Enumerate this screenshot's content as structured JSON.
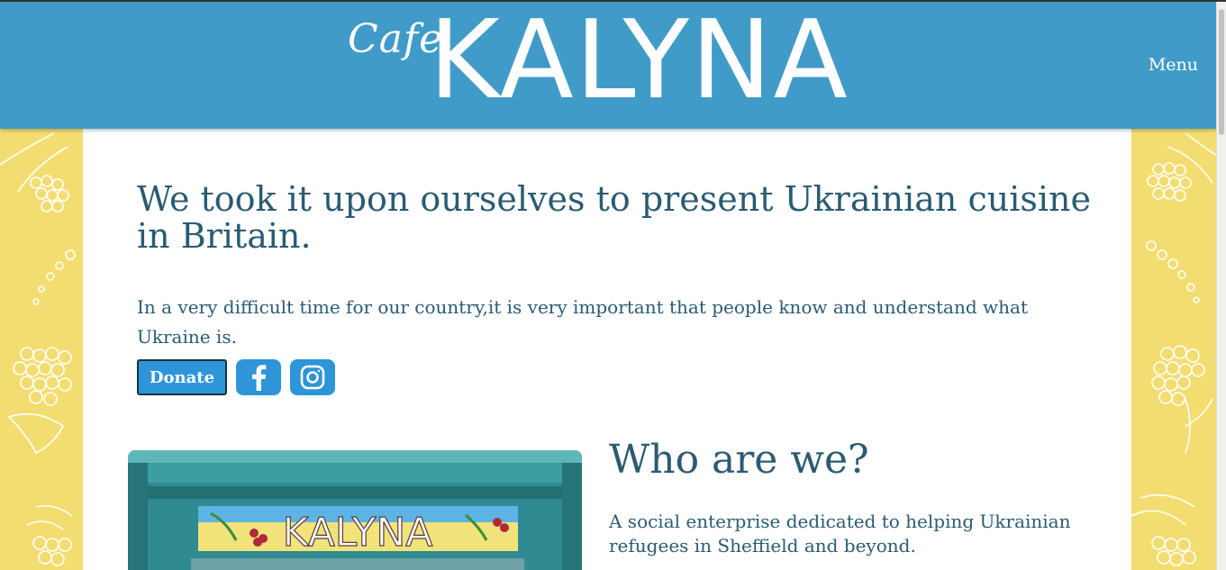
{
  "header": {
    "logo_small": "Cafe",
    "logo_main": "KALYNA",
    "menu_label": "Menu"
  },
  "hero": {
    "title": "We took it upon ourselves to present Ukrainian cuisine in Britain.",
    "text": "In a very difficult time for our country,it is very important that people know and understand what Ukraine is.",
    "donate_label": "Donate",
    "social_icons": [
      "facebook-icon",
      "instagram-icon"
    ]
  },
  "about": {
    "title": "Who are we?",
    "text": "A social enterprise dedicated to helping Ukrainian refugees in Sheffield and beyond.",
    "photo_sign": "KALYNA"
  },
  "colors": {
    "header_bg": "#419bc8",
    "side_bg": "#f4dd70",
    "text": "#2a5b73",
    "button": "#2e95d8"
  }
}
